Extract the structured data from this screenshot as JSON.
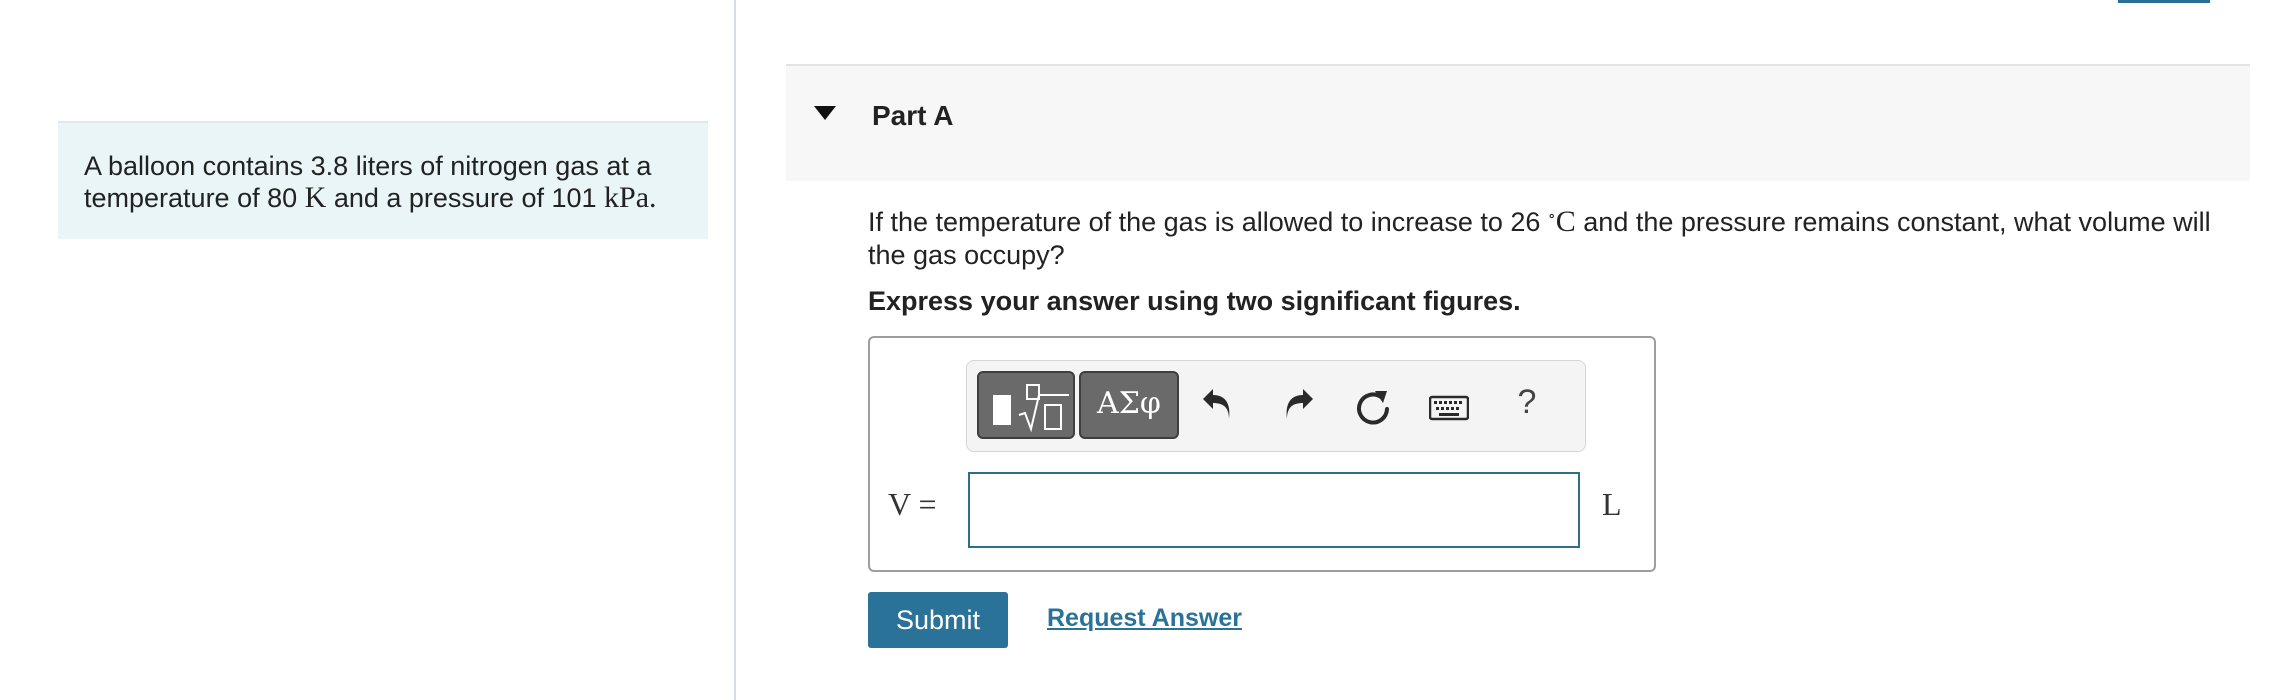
{
  "problem": {
    "text_1": "A balloon contains 3.8 liters of nitrogen gas at a",
    "text_2": "temperature of 80",
    "unit_k": "K",
    "text_3": "and a pressure of 101",
    "unit_kpa": "kPa",
    "text_end": "."
  },
  "part": {
    "title": "Part A"
  },
  "question": {
    "text_1": "If the temperature of the gas is allowed to increase to 26",
    "degree": "∘",
    "unit_c": "C",
    "text_2": "and the pressure remains constant, what volume will the gas occupy?",
    "instruction": "Express your answer using two significant figures."
  },
  "toolbar": {
    "greek_label": "ΑΣφ",
    "help_label": "?"
  },
  "answer": {
    "variable_label": "V =",
    "input_value": "",
    "unit": "L"
  },
  "actions": {
    "submit_label": "Submit",
    "request_answer_label": "Request Answer"
  },
  "colors": {
    "accent": "#2b7299",
    "problem_bg": "#e9f5f6",
    "header_bg": "#f7f7f7"
  }
}
